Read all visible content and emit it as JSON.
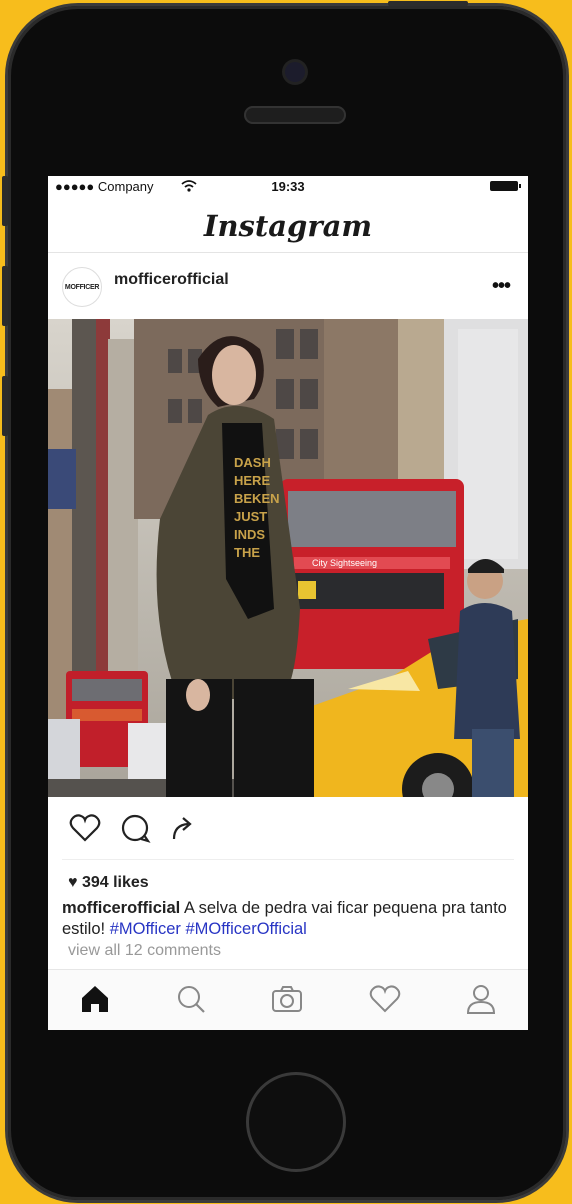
{
  "status_bar": {
    "signal": "●●●●● Company",
    "time": "19:33"
  },
  "header": {
    "logo": "Instagram"
  },
  "post": {
    "avatar_text": "MOFFICER",
    "username": "mofficerofficial",
    "more_label": "•••",
    "likes": "394 likes",
    "caption_username": "mofficerofficial",
    "caption_text": " A selva de pedra vai ficar pequena pra tanto estilo! ",
    "hashtags": [
      "#MOfficer",
      "#MOfficerOfficial"
    ],
    "comments_link": "view all 12 comments",
    "image": {
      "bus_sign": "City Sightseeing",
      "shirt_print": "DASH\nHERE\nBEKEN\nJUST\nINDS\nTHE"
    }
  },
  "tab_bar": {
    "items": [
      "home-icon",
      "search-icon",
      "camera-icon",
      "heart-icon",
      "profile-icon"
    ],
    "active": "home-icon"
  },
  "colors": {
    "background": "#f7bd1c",
    "phone": "#0c0c0c",
    "hashtag": "#2835c4",
    "taxi": "#f0b61e",
    "bus": "#c8202a"
  }
}
